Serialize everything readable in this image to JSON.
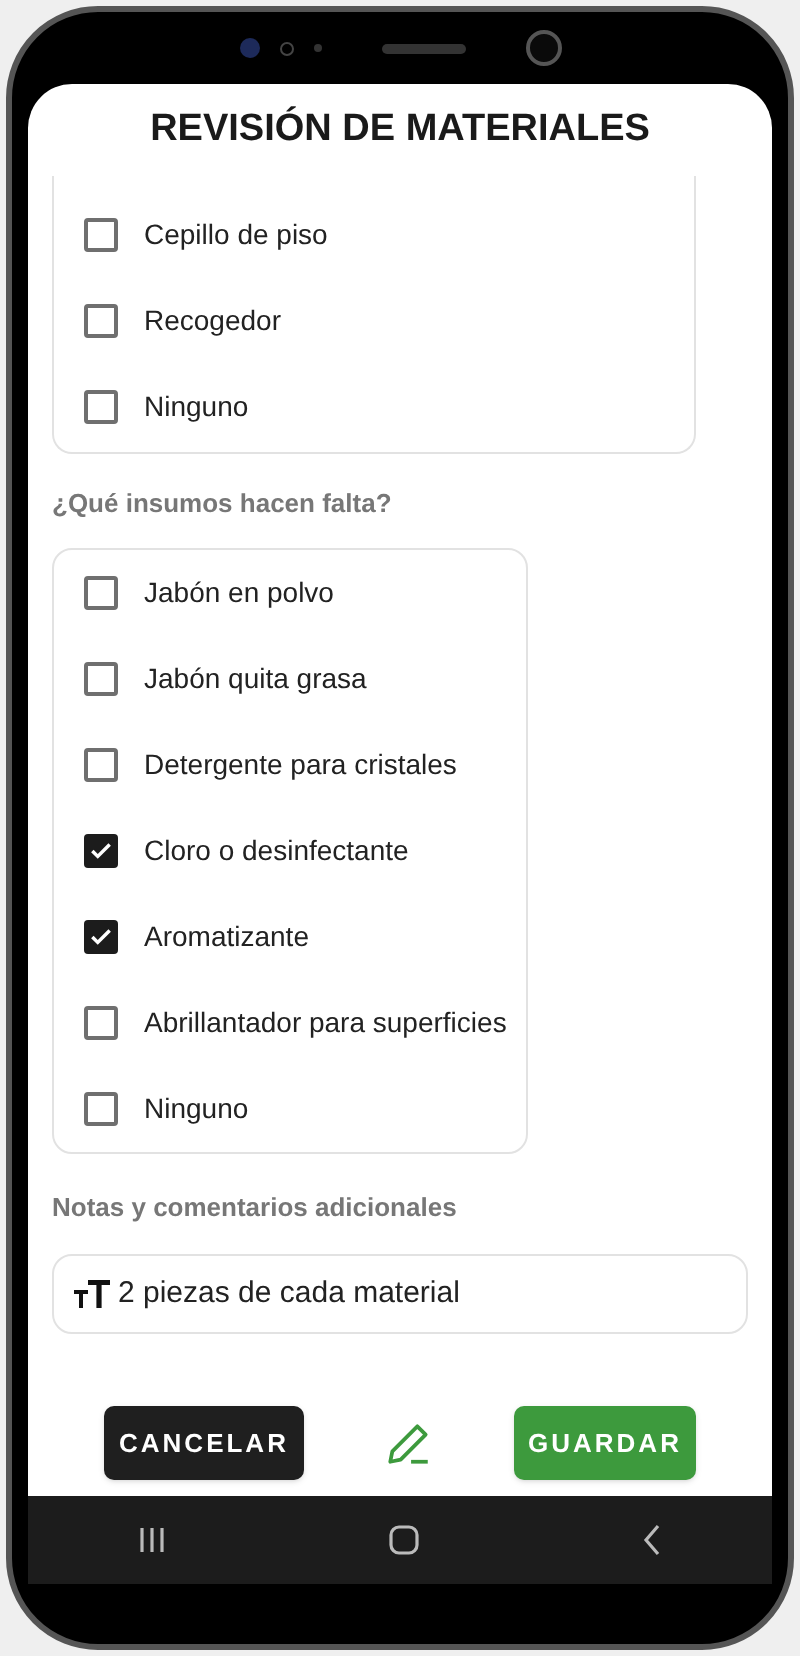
{
  "title": "REVISIÓN DE MATERIALES",
  "tools_list": [
    {
      "label": "Cepillo de piso",
      "checked": false
    },
    {
      "label": "Recogedor",
      "checked": false
    },
    {
      "label": "Ninguno",
      "checked": false
    }
  ],
  "supplies": {
    "question": "¿Qué insumos hacen falta?",
    "options": [
      {
        "label": "Jabón en polvo",
        "checked": false
      },
      {
        "label": "Jabón quita grasa",
        "checked": false
      },
      {
        "label": "Detergente para cristales",
        "checked": false
      },
      {
        "label": "Cloro o desinfectante",
        "checked": true
      },
      {
        "label": "Aromatizante",
        "checked": true
      },
      {
        "label": "Abrillantador para superficies",
        "checked": false
      },
      {
        "label": "Ninguno",
        "checked": false
      }
    ]
  },
  "notes": {
    "label": "Notas y comentarios adicionales",
    "value": "2 piezas de cada material"
  },
  "buttons": {
    "cancel": "CANCELAR",
    "save": "GUARDAR"
  }
}
